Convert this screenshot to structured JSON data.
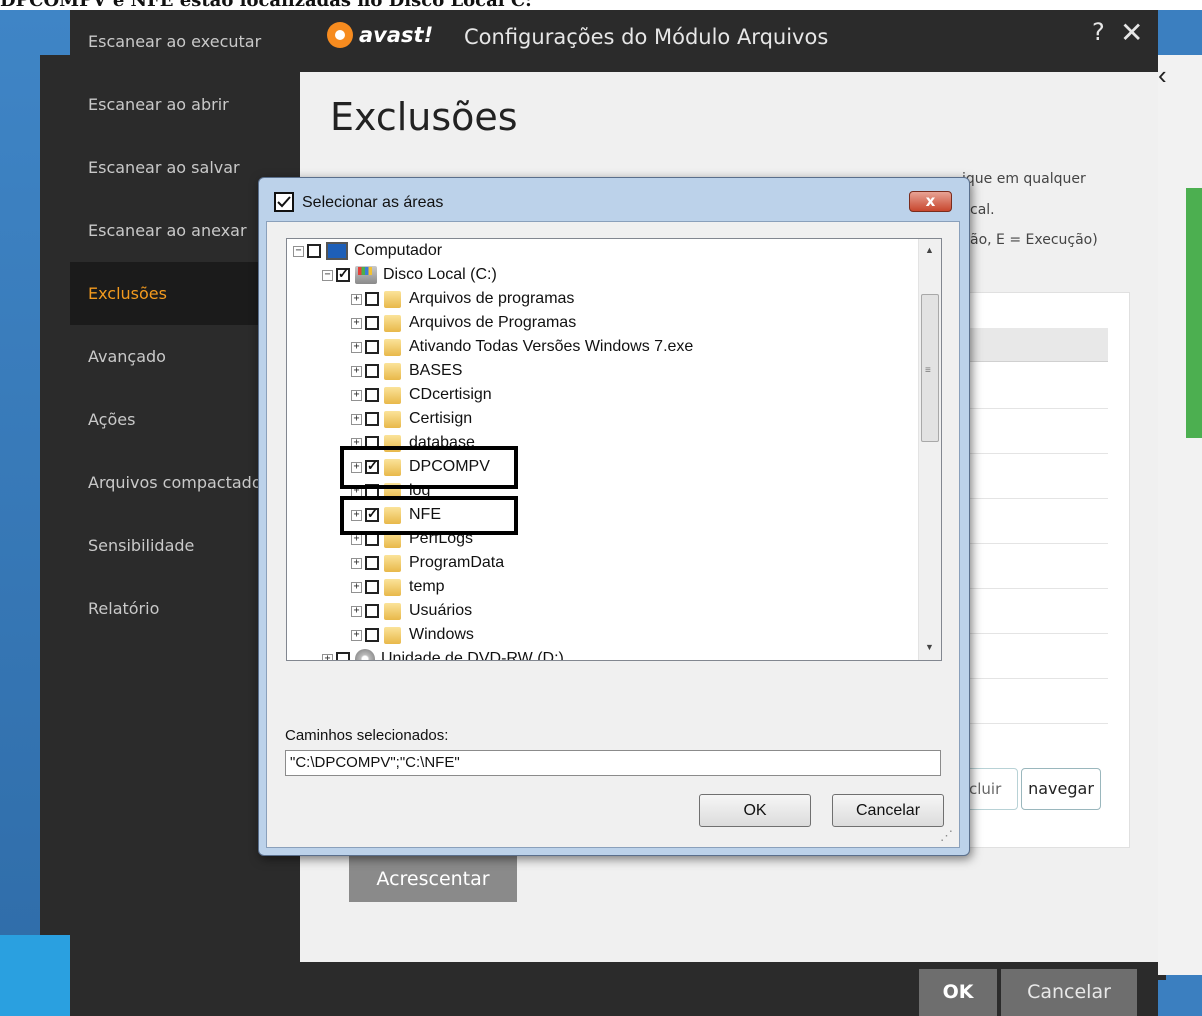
{
  "top_caption": "DPCOMPV e NFE estão localizadas no Disco Local C:",
  "module_window": {
    "logo_text": "avast!",
    "title": "Configurações do Módulo Arquivos",
    "help_icon": "?",
    "close_icon": "✕",
    "nav_items": [
      {
        "label": "Escanear ao executar"
      },
      {
        "label": "Escanear ao abrir"
      },
      {
        "label": "Escanear ao salvar"
      },
      {
        "label": "Escanear ao anexar"
      },
      {
        "label": "Exclusões",
        "active": true
      },
      {
        "label": "Avançado"
      },
      {
        "label": "Ações"
      },
      {
        "label": "Arquivos compactados"
      },
      {
        "label": "Sensibilidade"
      },
      {
        "label": "Relatório"
      }
    ],
    "page_title": "Exclusões",
    "description_fragments": [
      "ique em qualquer",
      "cal.",
      "ão, E = Execução)"
    ],
    "buttons": {
      "excluir_partial": "cluir",
      "navegar": "navegar",
      "acrescentar": "Acrescentar",
      "ok": "OK",
      "cancelar": "Cancelar"
    },
    "accent_color": "#f39a1e"
  },
  "dialog": {
    "title": "Selecionar as áreas",
    "close_glyph": "x",
    "tree": [
      {
        "label": "Computador",
        "level": 0,
        "expander": "⊟",
        "checked": false,
        "icon": "computer-icon"
      },
      {
        "label": "Disco Local (C:)",
        "level": 1,
        "expander": "⊟",
        "checked": true,
        "icon": "drive-icon"
      },
      {
        "label": "Arquivos de programas",
        "level": 2,
        "expander": "⊞",
        "checked": false,
        "icon": "folder-icon"
      },
      {
        "label": "Arquivos de Programas",
        "level": 2,
        "expander": "⊞",
        "checked": false,
        "icon": "folder-icon"
      },
      {
        "label": "Ativando Todas Versões Windows 7.exe",
        "level": 2,
        "expander": "⊞",
        "checked": false,
        "icon": "folder-icon"
      },
      {
        "label": "BASES",
        "level": 2,
        "expander": "⊞",
        "checked": false,
        "icon": "folder-icon"
      },
      {
        "label": "CDcertisign",
        "level": 2,
        "expander": "⊞",
        "checked": false,
        "icon": "folder-icon"
      },
      {
        "label": "Certisign",
        "level": 2,
        "expander": "⊞",
        "checked": false,
        "icon": "folder-icon"
      },
      {
        "label": "database",
        "level": 2,
        "expander": "⊞",
        "checked": false,
        "icon": "folder-icon"
      },
      {
        "label": "DPCOMPV",
        "level": 2,
        "expander": "⊞",
        "checked": true,
        "icon": "folder-icon"
      },
      {
        "label": "log",
        "level": 2,
        "expander": "⊞",
        "checked": false,
        "icon": "folder-icon"
      },
      {
        "label": "NFE",
        "level": 2,
        "expander": "⊞",
        "checked": true,
        "icon": "folder-icon"
      },
      {
        "label": "PerfLogs",
        "level": 2,
        "expander": "⊞",
        "checked": false,
        "icon": "folder-icon"
      },
      {
        "label": "ProgramData",
        "level": 2,
        "expander": "⊞",
        "checked": false,
        "icon": "folder-icon"
      },
      {
        "label": "temp",
        "level": 2,
        "expander": "⊞",
        "checked": false,
        "icon": "folder-icon"
      },
      {
        "label": "Usuários",
        "level": 2,
        "expander": "⊞",
        "checked": false,
        "icon": "folder-icon"
      },
      {
        "label": "Windows",
        "level": 2,
        "expander": "⊞",
        "checked": false,
        "icon": "folder-icon"
      },
      {
        "label": "Unidade de DVD-RW (D:)",
        "level": 1,
        "expander": "⊞",
        "checked": false,
        "icon": "dvd-icon"
      }
    ],
    "selected_paths_label": "Caminhos selecionados:",
    "selected_paths_value": "\"C:\\DPCOMPV\";\"C:\\NFE\"",
    "ok_label": "OK",
    "cancel_label": "Cancelar"
  }
}
